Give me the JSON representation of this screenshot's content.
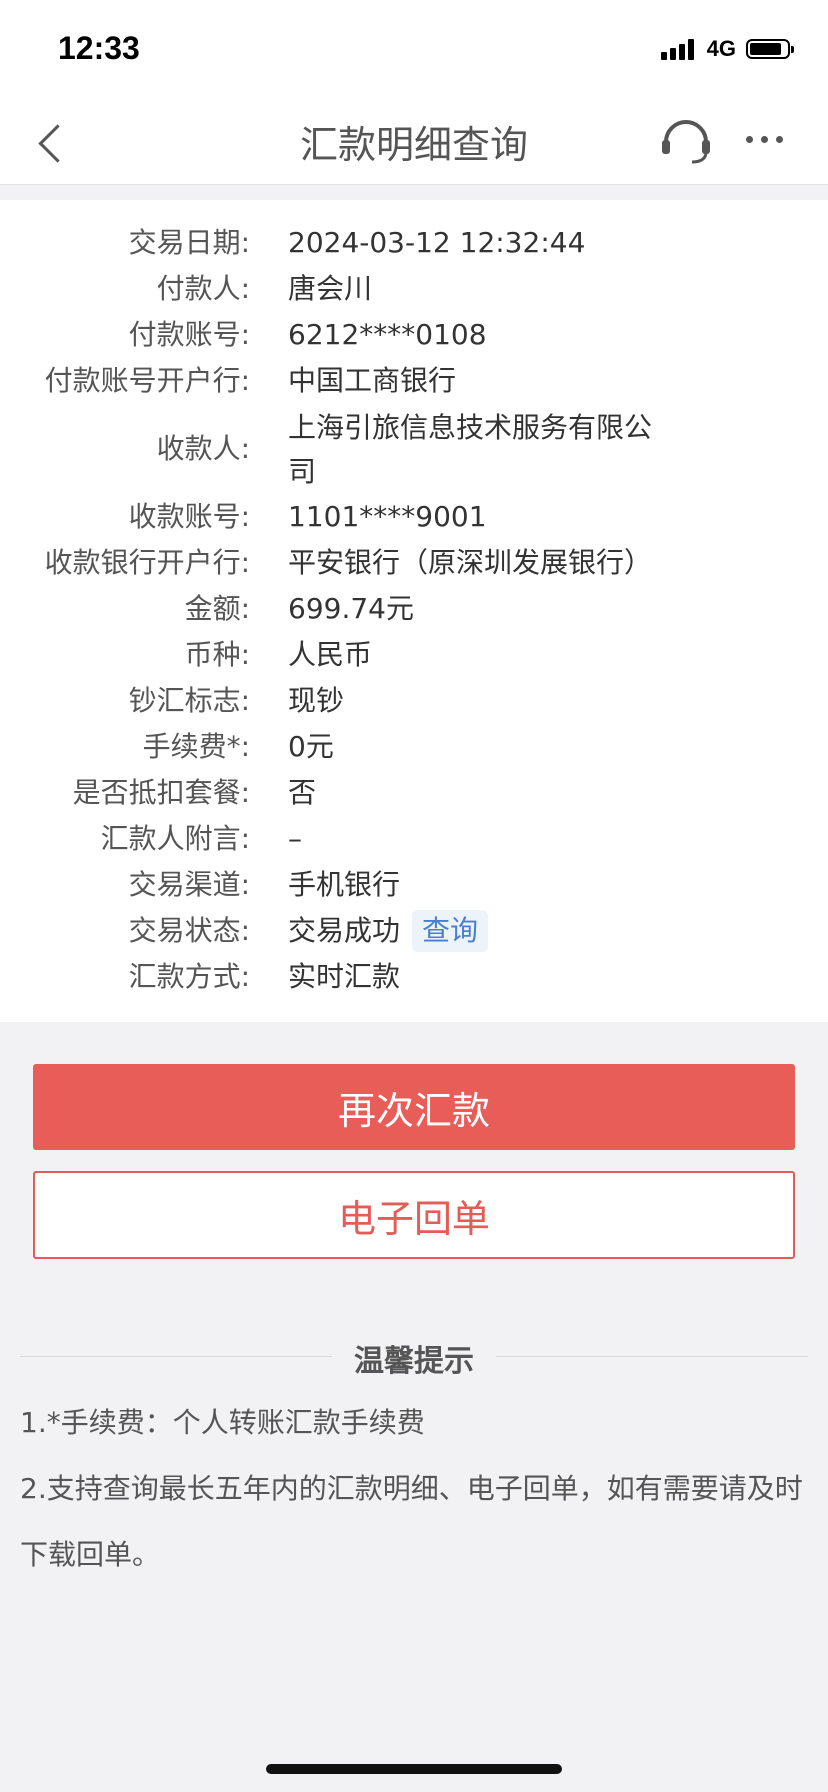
{
  "status_bar": {
    "time": "12:33",
    "network": "4G",
    "signal_bars": 4,
    "battery_level": 0.85
  },
  "nav": {
    "title": "汇款明细查询",
    "back_icon": "chevron-left-icon",
    "service_icon": "headset-icon",
    "more_icon": "more-dots-icon"
  },
  "details": [
    {
      "label": "交易日期:",
      "value": "2024-03-12 12:32:44"
    },
    {
      "label": "付款人:",
      "value": "唐会川"
    },
    {
      "label": "付款账号:",
      "value": "6212****0108"
    },
    {
      "label": "付款账号开户行:",
      "value": "中国工商银行"
    },
    {
      "label": "收款人:",
      "value": "上海引旅信息技术服务有限公司"
    },
    {
      "label": "收款账号:",
      "value": "1101****9001"
    },
    {
      "label": "收款银行开户行:",
      "value": "平安银行（原深圳发展银行）"
    },
    {
      "label": "金额:",
      "value": "699.74元"
    },
    {
      "label": "币种:",
      "value": "人民币"
    },
    {
      "label": "钞汇标志:",
      "value": "现钞"
    },
    {
      "label": "手续费*:",
      "value": "0元"
    },
    {
      "label": "是否抵扣套餐:",
      "value": "否"
    },
    {
      "label": "汇款人附言:",
      "value": "–"
    },
    {
      "label": "交易渠道:",
      "value": "手机银行"
    },
    {
      "label": "交易状态:",
      "value": "交易成功",
      "action": "查询"
    },
    {
      "label": "汇款方式:",
      "value": "实时汇款"
    }
  ],
  "buttons": {
    "remit_again": "再次汇款",
    "e_receipt": "电子回单"
  },
  "tips": {
    "title": "温馨提示",
    "items": [
      "1.*手续费：个人转账汇款手续费",
      "2.支持查询最长五年内的汇款明细、电子回单，如有需要请及时下载回单。"
    ]
  },
  "colors": {
    "primary": "#e85d58",
    "link": "#4a7fcd",
    "background": "#f2f2f4"
  }
}
